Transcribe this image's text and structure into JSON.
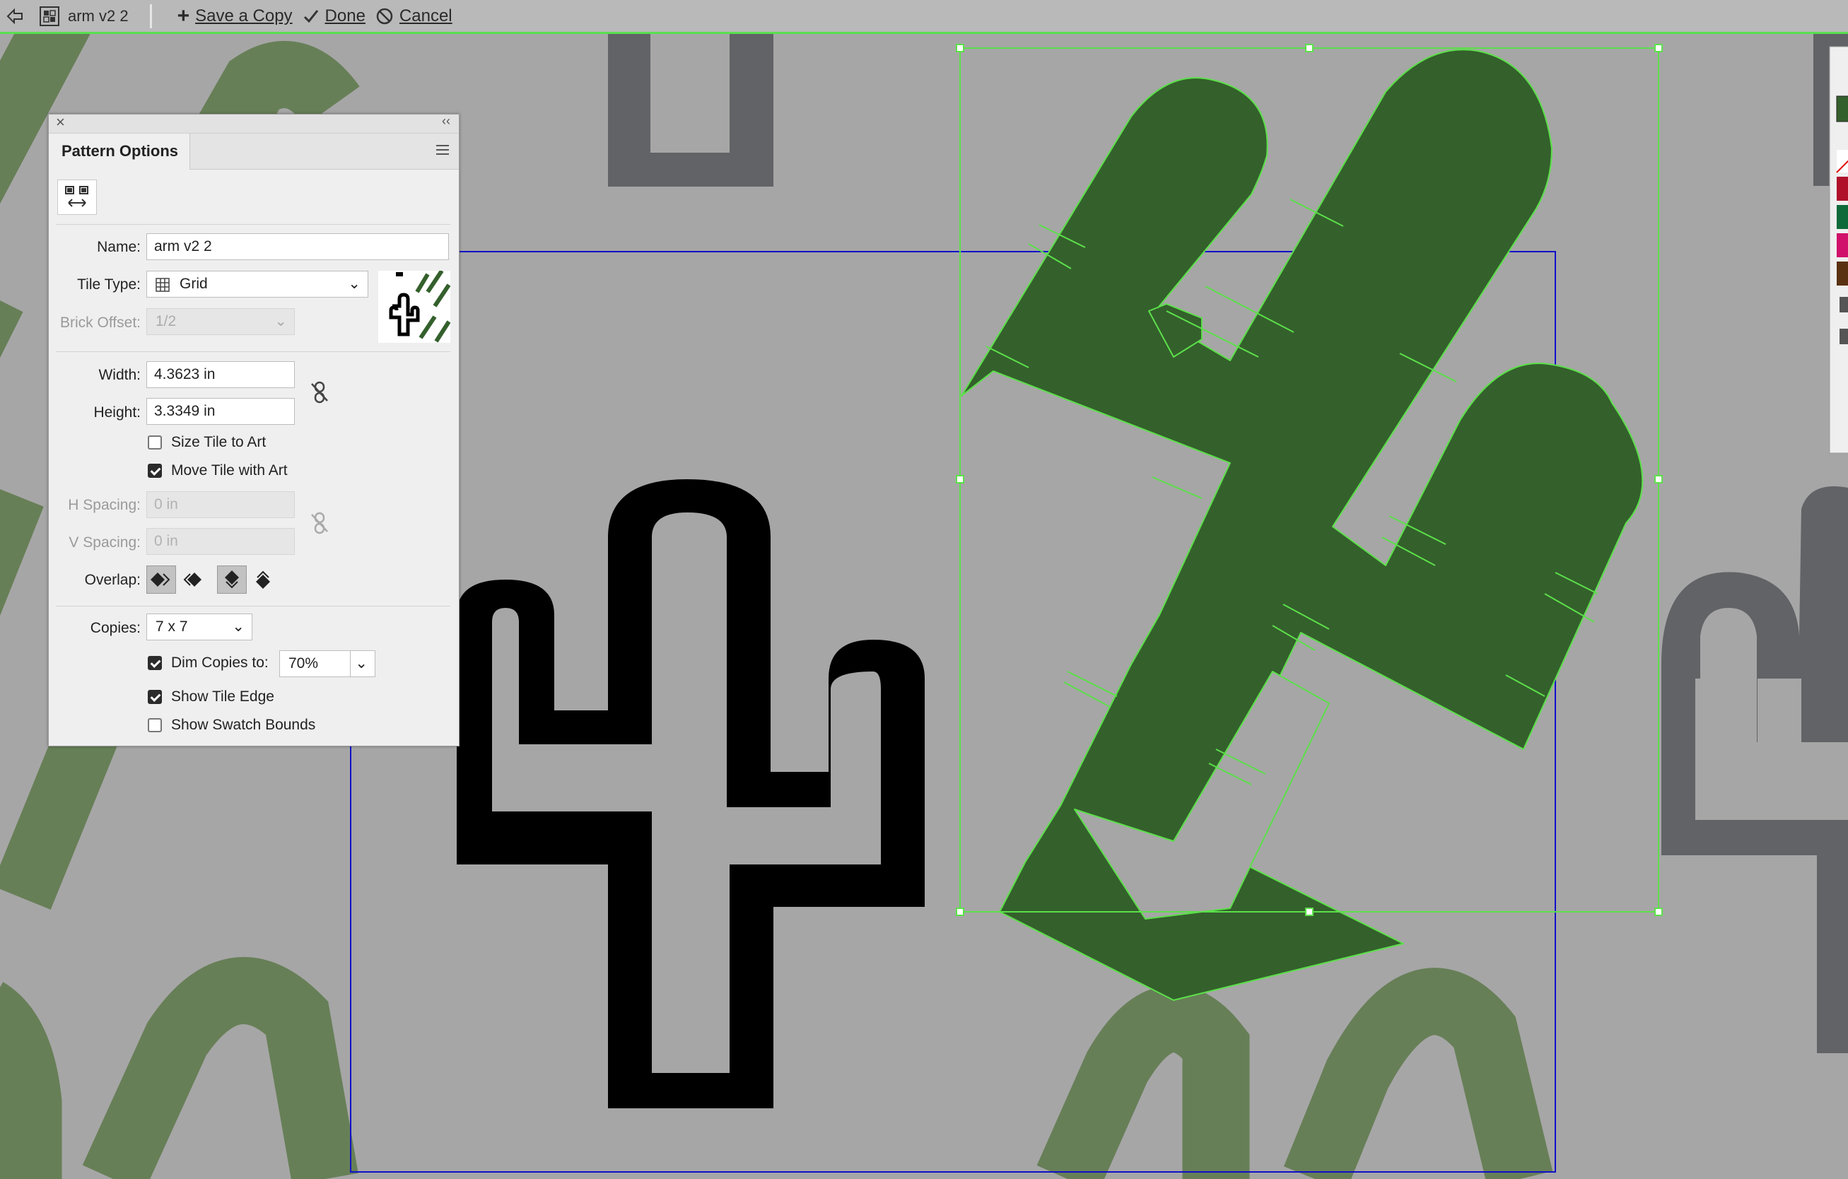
{
  "toolbar": {
    "doc_name": "arm v2 2",
    "save_copy": "Save a Copy",
    "done": "Done",
    "cancel": "Cancel"
  },
  "panel": {
    "title": "Pattern Options",
    "name_label": "Name:",
    "name_value": "arm v2 2",
    "tile_type_label": "Tile Type:",
    "tile_type_value": "Grid",
    "brick_offset_label": "Brick Offset:",
    "brick_offset_value": "1/2",
    "width_label": "Width:",
    "width_value": "4.3623 in",
    "height_label": "Height:",
    "height_value": "3.3349 in",
    "size_tile_label": "Size Tile to Art",
    "size_tile_checked": false,
    "move_tile_label": "Move Tile with Art",
    "move_tile_checked": true,
    "h_spacing_label": "H Spacing:",
    "h_spacing_value": "0 in",
    "v_spacing_label": "V Spacing:",
    "v_spacing_value": "0 in",
    "overlap_label": "Overlap:",
    "copies_label": "Copies:",
    "copies_value": "7 x 7",
    "dim_copies_label": "Dim Copies to:",
    "dim_copies_checked": true,
    "dim_copies_value": "70%",
    "show_tile_edge_label": "Show Tile Edge",
    "show_tile_edge_checked": true,
    "show_swatch_bounds_label": "Show Swatch Bounds",
    "show_swatch_bounds_checked": false
  },
  "colors": {
    "canvas_bg": "#a6a6a6",
    "selected_green": "#34602c",
    "dim_green": "#677f57",
    "gray_copy": "#626366",
    "tile_edge": "#1010c8",
    "selection": "#5ce04a"
  }
}
